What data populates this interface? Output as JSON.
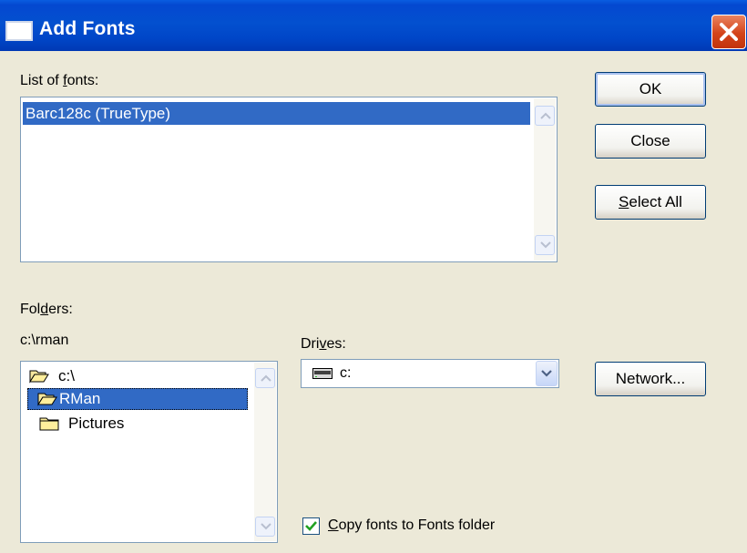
{
  "window": {
    "title": "Add Fonts",
    "close_icon": "close-icon"
  },
  "fonts_list": {
    "label_pre": "List of ",
    "label_access": "f",
    "label_post": "onts:",
    "items": [
      "Barc128c (TrueType)"
    ],
    "selected_index": 0
  },
  "folders": {
    "label_pre": "Fol",
    "label_access": "d",
    "label_post": "ers:",
    "current_path": "c:\\rman",
    "items": [
      {
        "name": "c:\\",
        "icon": "open-folder-icon"
      },
      {
        "name": "RMan",
        "icon": "open-folder-icon"
      },
      {
        "name": "Pictures",
        "icon": "folder-icon"
      }
    ],
    "selected_index": 1
  },
  "drives": {
    "label_pre": "Dri",
    "label_access": "v",
    "label_post": "es:",
    "selected": "c:",
    "icon": "drive-icon"
  },
  "buttons": {
    "ok": "OK",
    "close": "Close",
    "select_all_access": "S",
    "select_all_rest": "elect All",
    "network": "Network..."
  },
  "copy_option": {
    "label_access": "C",
    "label_rest": "opy fonts to Fonts folder",
    "checked": true
  }
}
